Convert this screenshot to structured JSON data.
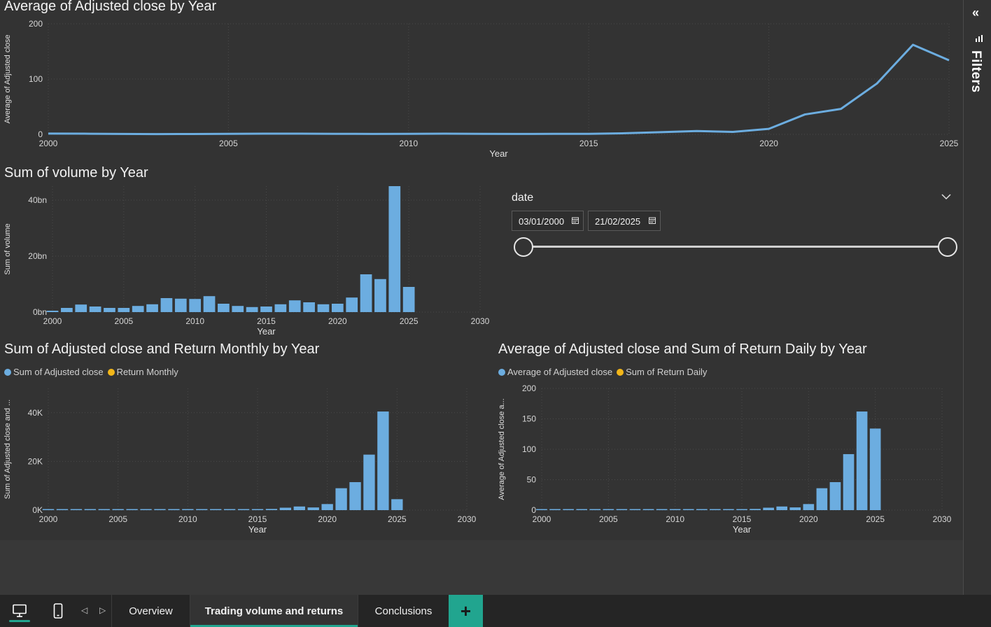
{
  "colors": {
    "series_blue": "#6cade0",
    "series_orange": "#f2b619",
    "accent": "#21a58f"
  },
  "filters": {
    "label": "Filters",
    "collapse_icon": "double-chevron-right-icon",
    "icon": "filter-icon"
  },
  "slicer": {
    "title": "date",
    "start_date": "03/01/2000",
    "end_date": "21/02/2025"
  },
  "tabs": {
    "items": [
      "Overview",
      "Trading volume and returns",
      "Conclusions"
    ],
    "active": "Trading volume and returns",
    "add_label": "+"
  },
  "view_buttons": [
    "desktop-view-icon",
    "mobile-view-icon"
  ],
  "chart_data": [
    {
      "type": "line",
      "title": "Average of Adjusted close by Year",
      "xlabel": "Year",
      "ylabel": "Average of Adjusted close",
      "xlim": [
        2000,
        2025
      ],
      "ylim": [
        0,
        200
      ],
      "xticks": [
        "2000",
        "2005",
        "2010",
        "2015",
        "2020",
        "2025"
      ],
      "yticks": [
        "0",
        "100",
        "200"
      ],
      "grid": true,
      "x": [
        2000,
        2001,
        2002,
        2003,
        2004,
        2005,
        2006,
        2007,
        2008,
        2009,
        2010,
        2011,
        2012,
        2013,
        2014,
        2015,
        2016,
        2017,
        2018,
        2019,
        2020,
        2021,
        2022,
        2023,
        2024,
        2025
      ],
      "series": [
        {
          "values": [
            1.5,
            1.2,
            0.8,
            0.5,
            0.6,
            1.0,
            1.2,
            1.2,
            1.0,
            0.8,
            1.0,
            1.2,
            1.0,
            0.8,
            0.9,
            1.0,
            2.0,
            4.0,
            6.0,
            4.5,
            10,
            36,
            46,
            92,
            162,
            134
          ]
        }
      ]
    },
    {
      "type": "bar",
      "title": "Sum of volume by Year",
      "xlabel": "Year",
      "ylabel": "Sum of volume",
      "xlim": [
        2000,
        2030
      ],
      "ylim": [
        0,
        45
      ],
      "xticks": [
        "2000",
        "2005",
        "2010",
        "2015",
        "2020",
        "2025",
        "2030"
      ],
      "yticks": [
        "0bn",
        "20bn",
        "40bn"
      ],
      "grid": true,
      "x": [
        2000,
        2001,
        2002,
        2003,
        2004,
        2005,
        2006,
        2007,
        2008,
        2009,
        2010,
        2011,
        2012,
        2013,
        2014,
        2015,
        2016,
        2017,
        2018,
        2019,
        2020,
        2021,
        2022,
        2023,
        2024,
        2025
      ],
      "series": [
        {
          "values": [
            0.5,
            1.5,
            2.7,
            2.0,
            1.5,
            1.5,
            2.2,
            2.8,
            5.0,
            4.8,
            4.7,
            5.7,
            3.0,
            2.2,
            1.8,
            2.0,
            2.8,
            4.2,
            3.5,
            2.8,
            3.0,
            5.2,
            13.5,
            11.8,
            45.5,
            9.0
          ]
        }
      ]
    },
    {
      "type": "bar",
      "title": "Sum of Adjusted close and Return Monthly by Year",
      "xlabel": "Year",
      "ylabel": "Sum of Adjusted close and ...",
      "xlim": [
        2000,
        2030
      ],
      "ylim": [
        0,
        50000
      ],
      "xticks": [
        "2000",
        "2005",
        "2010",
        "2015",
        "2020",
        "2025",
        "2030"
      ],
      "yticks": [
        "0K",
        "20K",
        "40K"
      ],
      "legend": "top-left",
      "grid": true,
      "x": [
        2000,
        2001,
        2002,
        2003,
        2004,
        2005,
        2006,
        2007,
        2008,
        2009,
        2010,
        2011,
        2012,
        2013,
        2014,
        2015,
        2016,
        2017,
        2018,
        2019,
        2020,
        2021,
        2022,
        2023,
        2024,
        2025
      ],
      "series": [
        {
          "name": "Sum of Adjusted close",
          "values": [
            400,
            300,
            200,
            150,
            150,
            250,
            300,
            300,
            250,
            200,
            250,
            300,
            250,
            200,
            200,
            250,
            500,
            1000,
            1500,
            1100,
            2500,
            9000,
            11500,
            22800,
            40500,
            4500
          ]
        },
        {
          "name": "Return Monthly",
          "values": []
        }
      ]
    },
    {
      "type": "bar",
      "title": "Average of Adjusted close and Sum of Return Daily by Year",
      "xlabel": "Year",
      "ylabel": "Average of Adjusted close a...",
      "xlim": [
        2000,
        2030
      ],
      "ylim": [
        0,
        200
      ],
      "xticks": [
        "2000",
        "2005",
        "2010",
        "2015",
        "2020",
        "2025",
        "2030"
      ],
      "yticks": [
        "0",
        "50",
        "100",
        "150",
        "200"
      ],
      "legend": "top-left",
      "grid": true,
      "x": [
        2000,
        2001,
        2002,
        2003,
        2004,
        2005,
        2006,
        2007,
        2008,
        2009,
        2010,
        2011,
        2012,
        2013,
        2014,
        2015,
        2016,
        2017,
        2018,
        2019,
        2020,
        2021,
        2022,
        2023,
        2024,
        2025
      ],
      "series": [
        {
          "name": "Average of Adjusted close",
          "values": [
            1.5,
            1.2,
            0.8,
            0.5,
            0.6,
            1.0,
            1.2,
            1.2,
            1.0,
            0.8,
            1.0,
            1.2,
            1.0,
            0.8,
            0.9,
            1.0,
            2.0,
            4.0,
            6.0,
            4.5,
            10,
            36,
            46,
            92,
            162,
            134
          ]
        },
        {
          "name": "Sum of Return Daily",
          "values": []
        }
      ]
    }
  ]
}
